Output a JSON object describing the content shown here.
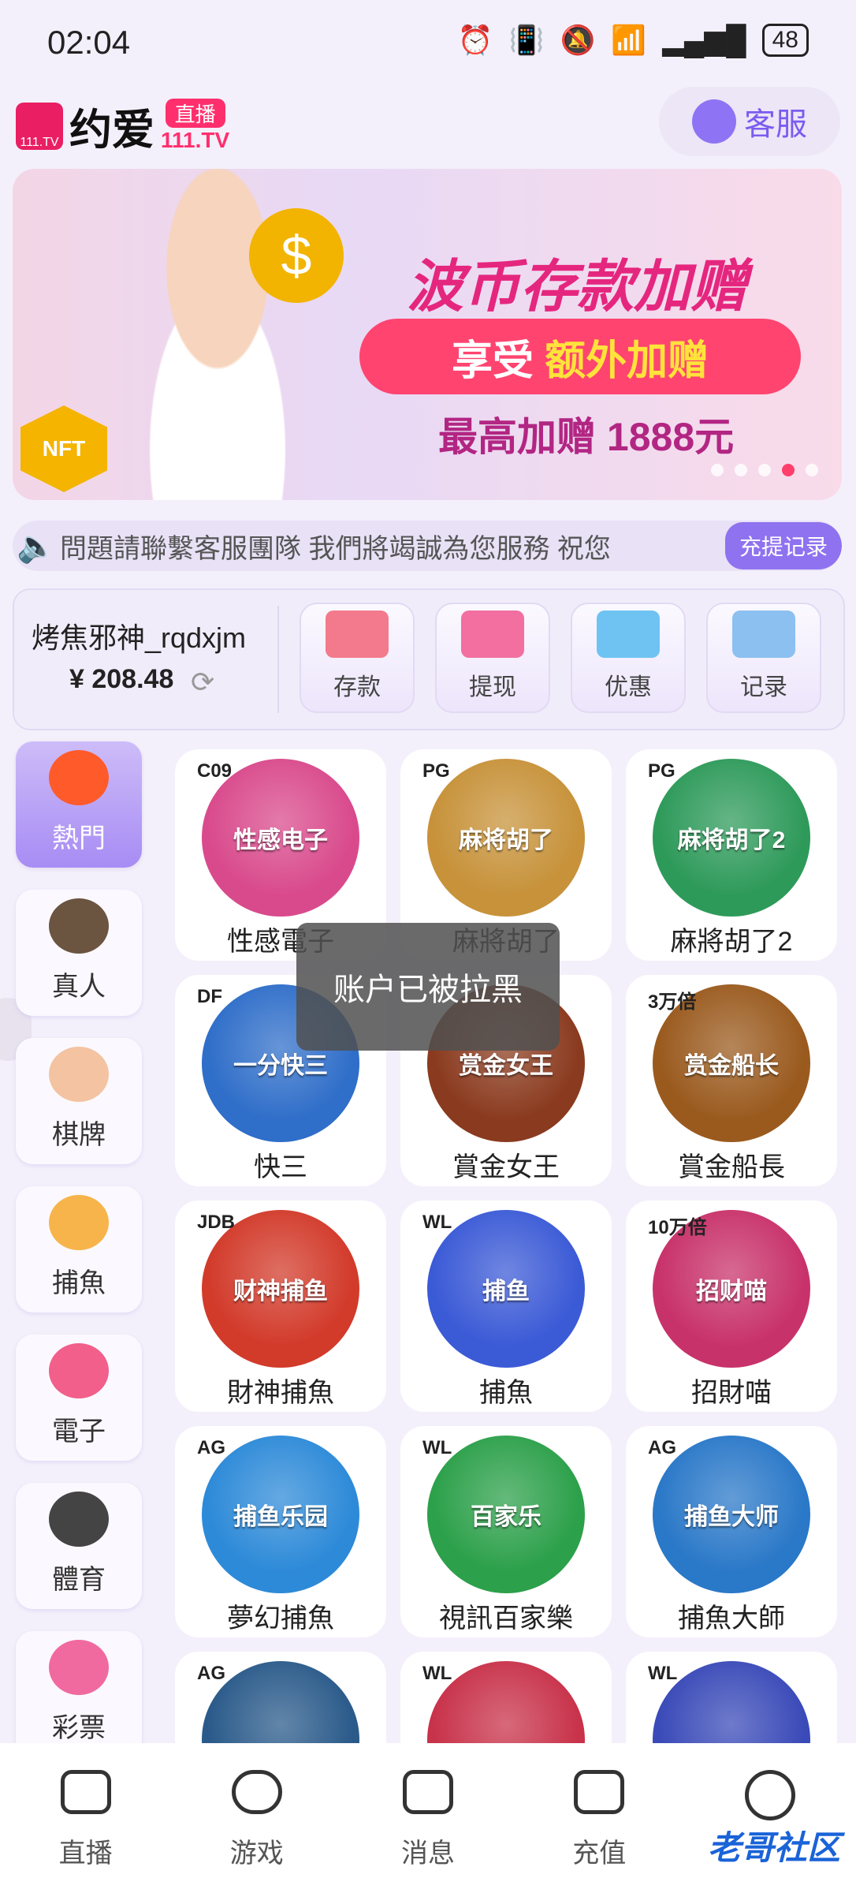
{
  "status": {
    "time": "02:04",
    "battery": "48"
  },
  "header": {
    "logo_sub": "111.TV",
    "app_name": "约爱",
    "badge_top": "直播",
    "badge_bottom": "111.TV",
    "service_label": "客服"
  },
  "banner": {
    "nft_label": "NFT",
    "title": "波币存款加赠",
    "pill_text_1": "享受",
    "pill_text_2": "额外加赠",
    "subtitle": "最高加赠 1888元"
  },
  "marquee": {
    "text": "問題請聯繫客服團隊 我們將竭誠為您服務 祝您",
    "records_button": "充提记录"
  },
  "user": {
    "name": "烤焦邪神_rqdxjm",
    "balance": "¥ 208.48"
  },
  "quick_actions": [
    {
      "label": "存款",
      "color": "#f37a8c"
    },
    {
      "label": "提现",
      "color": "#f26fa0"
    },
    {
      "label": "优惠",
      "color": "#6ec3f3"
    },
    {
      "label": "记录",
      "color": "#8bc0f0"
    }
  ],
  "categories": [
    {
      "label": "熱門",
      "color": "#ff5a2a"
    },
    {
      "label": "真人",
      "color": "#6b5440"
    },
    {
      "label": "棋牌",
      "color": "#f3c3a2"
    },
    {
      "label": "捕魚",
      "color": "#f6b44a"
    },
    {
      "label": "電子",
      "color": "#f15f8a"
    },
    {
      "label": "體育",
      "color": "#444444"
    },
    {
      "label": "彩票",
      "color": "#f06aa0"
    }
  ],
  "games": [
    {
      "name": "性感電子",
      "tag": "C09",
      "art_text": "性感电子",
      "color": "#d94a8c"
    },
    {
      "name": "麻將胡了",
      "tag": "PG",
      "art_text": "麻将胡了",
      "color": "#c7923a"
    },
    {
      "name": "麻將胡了2",
      "tag": "PG",
      "art_text": "麻将胡了2",
      "color": "#2e9a5a"
    },
    {
      "name": "快三",
      "tag": "DF",
      "art_text": "一分快三",
      "color": "#2f6ec9"
    },
    {
      "name": "賞金女王",
      "tag": "",
      "art_text": "赏金女王",
      "color": "#8a3a1e"
    },
    {
      "name": "賞金船長",
      "tag": "3万倍",
      "art_text": "赏金船长",
      "color": "#9a5a1e"
    },
    {
      "name": "財神捕魚",
      "tag": "JDB",
      "art_text": "财神捕鱼",
      "color": "#d23a2a"
    },
    {
      "name": "捕魚",
      "tag": "WL",
      "art_text": "捕鱼",
      "color": "#3b5ad6"
    },
    {
      "name": "招財喵",
      "tag": "10万倍",
      "art_text": "招财喵",
      "color": "#c8326a"
    },
    {
      "name": "夢幻捕魚",
      "tag": "AG",
      "art_text": "捕鱼乐园",
      "color": "#2d8ad8"
    },
    {
      "name": "視訊百家樂",
      "tag": "WL",
      "art_text": "百家乐",
      "color": "#2ca04a"
    },
    {
      "name": "捕魚大師",
      "tag": "AG",
      "art_text": "捕鱼大师",
      "color": "#2a78c8"
    },
    {
      "name": "",
      "tag": "AG",
      "art_text": "",
      "color": "#2a5a8a"
    },
    {
      "name": "",
      "tag": "WL",
      "art_text": "",
      "color": "#c8324a"
    },
    {
      "name": "",
      "tag": "WL",
      "art_text": "",
      "color": "#3a4ab8"
    }
  ],
  "toast": "账户已被拉黑",
  "nav": [
    "直播",
    "游戏",
    "消息",
    "充值",
    ""
  ],
  "watermark": "老哥社区"
}
